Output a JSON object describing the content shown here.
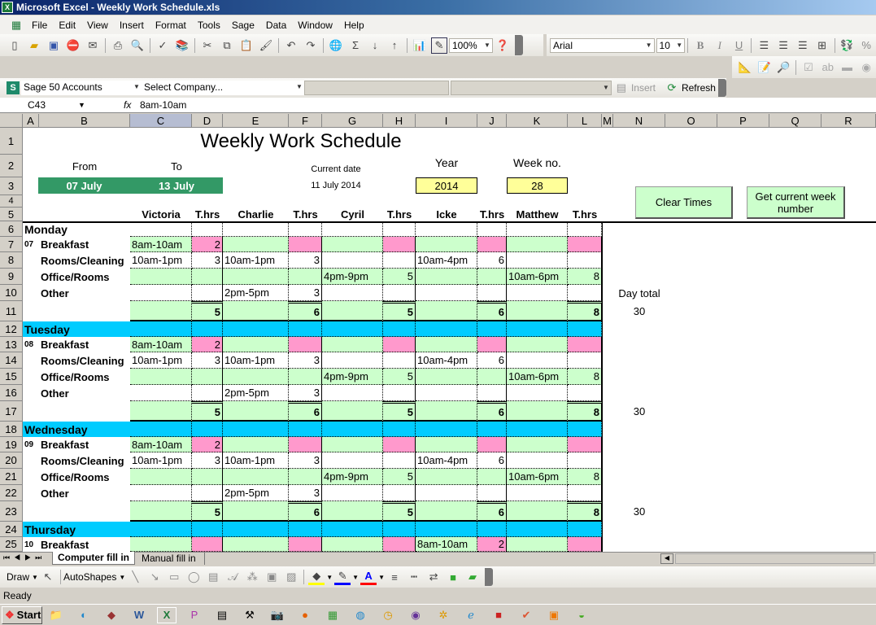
{
  "window": {
    "title": "Microsoft Excel - Weekly Work Schedule.xls"
  },
  "menu": [
    "File",
    "Edit",
    "View",
    "Insert",
    "Format",
    "Tools",
    "Sage",
    "Data",
    "Window",
    "Help"
  ],
  "toolbar": {
    "zoom": "100%",
    "font": "Arial",
    "font_size": "10",
    "bold": "B",
    "italic": "I",
    "underline": "U",
    "percent": "%"
  },
  "sage_bar": {
    "account": "Sage 50 Accounts",
    "company_placeholder": "Select Company...",
    "insert": "Insert",
    "refresh": "Refresh"
  },
  "formula_bar": {
    "name_box": "C43",
    "fx": "fx",
    "value": "8am-10am"
  },
  "columns": [
    "A",
    "B",
    "C",
    "D",
    "E",
    "F",
    "G",
    "H",
    "I",
    "J",
    "K",
    "L",
    "M",
    "N",
    "O",
    "P",
    "Q",
    "R"
  ],
  "selected_column": "C",
  "sheet": {
    "title": "Weekly Work Schedule",
    "from_label": "From",
    "to_label": "To",
    "from_value": "07  July",
    "to_value": "13  July",
    "current_date_label": "Current date",
    "current_date": "11 July 2014",
    "year_label": "Year",
    "year": "2014",
    "week_label": "Week no.",
    "week": "28",
    "clear_button": "Clear Times",
    "week_button": "Get current week number",
    "staff": [
      "Victoria",
      "Charlie",
      "Cyril",
      "Icke",
      "Matthew"
    ],
    "thrs": "T.hrs",
    "day_total_label": "Day total",
    "days": [
      {
        "name": "Monday",
        "date": "07",
        "rows": [
          {
            "task": "Breakfast",
            "cells": [
              "8am-10am",
              "2",
              "",
              "",
              "",
              "",
              "",
              "",
              "",
              ""
            ]
          },
          {
            "task": "Rooms/Cleaning",
            "cells": [
              "10am-1pm",
              "3",
              "10am-1pm",
              "3",
              "",
              "",
              "10am-4pm",
              "6",
              "",
              ""
            ]
          },
          {
            "task": "Office/Rooms",
            "cells": [
              "",
              "",
              "",
              "",
              "4pm-9pm",
              "5",
              "",
              "",
              "10am-6pm",
              "8"
            ]
          },
          {
            "task": "Other",
            "cells": [
              "",
              "",
              "2pm-5pm",
              "3",
              "",
              "",
              "",
              "",
              "",
              ""
            ]
          }
        ],
        "totals": [
          "5",
          "6",
          "5",
          "6",
          "8"
        ],
        "day_total": "30"
      },
      {
        "name": "Tuesday",
        "date": "08",
        "rows": [
          {
            "task": "Breakfast",
            "cells": [
              "8am-10am",
              "2",
              "",
              "",
              "",
              "",
              "",
              "",
              "",
              ""
            ]
          },
          {
            "task": "Rooms/Cleaning",
            "cells": [
              "10am-1pm",
              "3",
              "10am-1pm",
              "3",
              "",
              "",
              "10am-4pm",
              "6",
              "",
              ""
            ]
          },
          {
            "task": "Office/Rooms",
            "cells": [
              "",
              "",
              "",
              "",
              "4pm-9pm",
              "5",
              "",
              "",
              "10am-6pm",
              "8"
            ]
          },
          {
            "task": "Other",
            "cells": [
              "",
              "",
              "2pm-5pm",
              "3",
              "",
              "",
              "",
              "",
              "",
              ""
            ]
          }
        ],
        "totals": [
          "5",
          "6",
          "5",
          "6",
          "8"
        ],
        "day_total": "30"
      },
      {
        "name": "Wednesday",
        "date": "09",
        "rows": [
          {
            "task": "Breakfast",
            "cells": [
              "8am-10am",
              "2",
              "",
              "",
              "",
              "",
              "",
              "",
              "",
              ""
            ]
          },
          {
            "task": "Rooms/Cleaning",
            "cells": [
              "10am-1pm",
              "3",
              "10am-1pm",
              "3",
              "",
              "",
              "10am-4pm",
              "6",
              "",
              ""
            ]
          },
          {
            "task": "Office/Rooms",
            "cells": [
              "",
              "",
              "",
              "",
              "4pm-9pm",
              "5",
              "",
              "",
              "10am-6pm",
              "8"
            ]
          },
          {
            "task": "Other",
            "cells": [
              "",
              "",
              "2pm-5pm",
              "3",
              "",
              "",
              "",
              "",
              "",
              ""
            ]
          }
        ],
        "totals": [
          "5",
          "6",
          "5",
          "6",
          "8"
        ],
        "day_total": "30"
      },
      {
        "name": "Thursday",
        "date": "10",
        "rows": [
          {
            "task": "Breakfast",
            "cells": [
              "",
              "",
              "",
              "",
              "",
              "",
              "8am-10am",
              "2",
              "",
              ""
            ]
          }
        ]
      }
    ]
  },
  "sheet_tabs": [
    "Computer fill in",
    "Manual fill in"
  ],
  "active_tab": "Computer fill in",
  "drawing": {
    "draw": "Draw",
    "autoshapes": "AutoShapes"
  },
  "status": "Ready",
  "taskbar": {
    "start": "Start"
  },
  "colors": {
    "green_fill": "#ccffcc",
    "pink_fill": "#ff99cc",
    "day_header": "#00ccff",
    "date_fill": "#339966",
    "yellow": "#ffff99"
  }
}
